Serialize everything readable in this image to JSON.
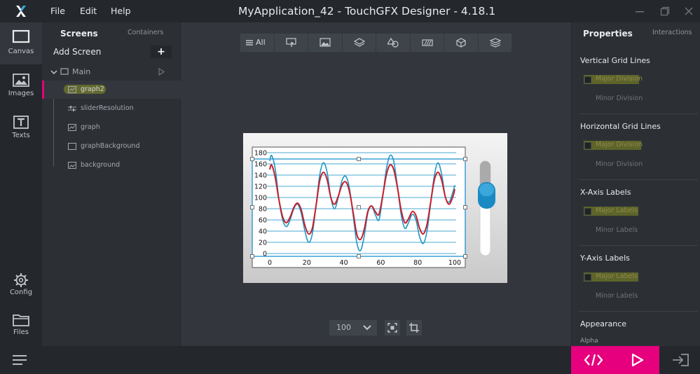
{
  "titlebar": {
    "menu": [
      "File",
      "Edit",
      "Help"
    ],
    "title": "MyApplication_42 - TouchGFX Designer - 4.18.1"
  },
  "rail": {
    "items": [
      {
        "label": "Canvas",
        "icon": "canvas-icon",
        "active": true
      },
      {
        "label": "Images",
        "icon": "image-icon"
      },
      {
        "label": "Texts",
        "icon": "text-icon"
      },
      {
        "label": "Config",
        "icon": "gear-icon"
      },
      {
        "label": "Files",
        "icon": "folder-icon"
      }
    ]
  },
  "screens_panel": {
    "tab_screens": "Screens",
    "tab_containers": "Containers",
    "add_screen": "Add Screen",
    "add_button": "+",
    "screen_name": "Main",
    "widgets": [
      {
        "name": "graph2",
        "icon": "graph-widget-icon",
        "selected": true
      },
      {
        "name": "sliderResolution",
        "icon": "slider-widget-icon"
      },
      {
        "name": "graph",
        "icon": "graph-widget-icon"
      },
      {
        "name": "graphBackground",
        "icon": "box-widget-icon"
      },
      {
        "name": "background",
        "icon": "image-widget-icon"
      }
    ]
  },
  "toolbar": {
    "all_label": "All"
  },
  "canvas": {
    "zoom": "100"
  },
  "chart_data": {
    "type": "line",
    "title": "",
    "xlabel": "",
    "ylabel": "",
    "xlim": [
      0,
      100
    ],
    "ylim": [
      0,
      180
    ],
    "x_ticks": [
      0,
      20,
      40,
      60,
      80,
      100
    ],
    "y_ticks": [
      0,
      20,
      40,
      60,
      80,
      100,
      120,
      140,
      160,
      180
    ],
    "grid": "horizontal",
    "series": [
      {
        "color": "#2196c4",
        "x": [
          0,
          1,
          3,
          5,
          7,
          9,
          11,
          13,
          15,
          17,
          19,
          21,
          23,
          25,
          27,
          29,
          31,
          33,
          35,
          37,
          39,
          41,
          43,
          45,
          47,
          49,
          51,
          53,
          55,
          57,
          59,
          61,
          63,
          65,
          67,
          69,
          71,
          73,
          75,
          77,
          79,
          81,
          83,
          85,
          87,
          89,
          91,
          93,
          95,
          97,
          99,
          100
        ],
        "y": [
          165,
          175,
          150,
          95,
          60,
          48,
          60,
          80,
          88,
          72,
          40,
          20,
          35,
          85,
          140,
          162,
          145,
          100,
          80,
          100,
          130,
          138,
          118,
          70,
          20,
          5,
          30,
          72,
          85,
          70,
          60,
          100,
          150,
          175,
          165,
          120,
          70,
          45,
          55,
          70,
          60,
          30,
          18,
          40,
          90,
          140,
          162,
          140,
          100,
          92,
          110,
          122
        ]
      },
      {
        "color": "#c81e2a",
        "x": [
          0,
          1,
          3,
          5,
          7,
          9,
          11,
          13,
          15,
          17,
          19,
          21,
          23,
          25,
          27,
          29,
          31,
          33,
          35,
          37,
          39,
          41,
          43,
          45,
          47,
          49,
          51,
          53,
          55,
          57,
          59,
          61,
          63,
          65,
          67,
          69,
          71,
          73,
          75,
          77,
          79,
          81,
          83,
          85,
          87,
          89,
          91,
          93,
          95,
          97,
          99,
          100
        ],
        "y": [
          150,
          158,
          135,
          95,
          65,
          55,
          65,
          82,
          90,
          78,
          50,
          35,
          45,
          85,
          130,
          145,
          132,
          100,
          88,
          102,
          122,
          128,
          112,
          75,
          35,
          25,
          42,
          75,
          85,
          75,
          70,
          102,
          140,
          158,
          150,
          118,
          78,
          55,
          62,
          75,
          68,
          45,
          35,
          52,
          92,
          132,
          145,
          130,
          100,
          88,
          102,
          115
        ]
      }
    ]
  },
  "properties": {
    "title": "Properties",
    "interactions": "Interactions",
    "sections": [
      {
        "title": "Vertical Grid Lines",
        "major": "Major Division",
        "minor": "Minor Division"
      },
      {
        "title": "Horizontal Grid Lines",
        "major": "Major Division",
        "minor": "Minor Division"
      },
      {
        "title": "X-Axis Labels",
        "major": "Major Labels",
        "minor": "Minor Labels"
      },
      {
        "title": "Y-Axis Labels",
        "major": "Major Labels",
        "minor": "Minor Labels"
      }
    ],
    "appearance": "Appearance",
    "alpha": "Alpha"
  },
  "colors": {
    "accent": "#e6007e",
    "highlight": "#c8d214",
    "graph_line_blue": "#2196c4",
    "graph_line_red": "#c81e2a",
    "slider_knob": "#1a8ac4"
  }
}
